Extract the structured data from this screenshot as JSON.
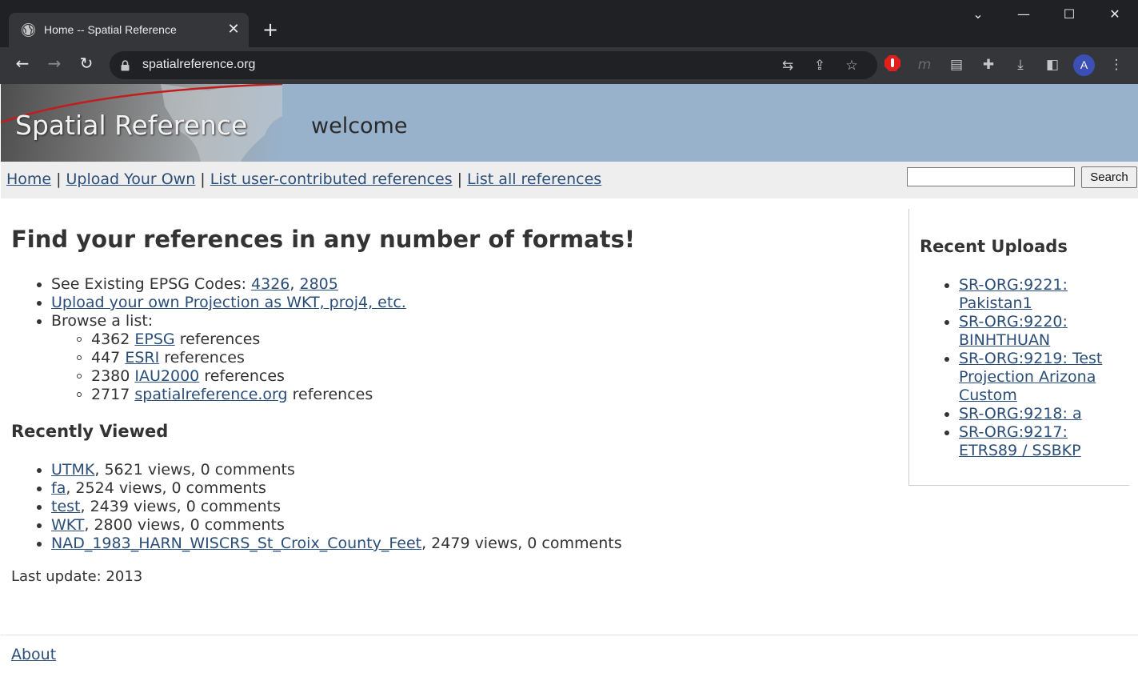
{
  "browser": {
    "tab_title": "Home -- Spatial Reference",
    "new_tab_label": "+",
    "url": "spatialreference.org"
  },
  "site": {
    "logo_text": "Spatial Reference",
    "banner_heading": "welcome"
  },
  "nav": {
    "links": [
      "Home",
      "Upload Your Own",
      "List user-contributed references",
      "List all references"
    ],
    "separator": "|",
    "search_button": "Search",
    "search_value": ""
  },
  "main": {
    "heading": "Find your references in any number of formats!",
    "existing_prefix": "See Existing EPSG Codes: ",
    "existing_codes": [
      "4326",
      "2805"
    ],
    "upload_link": "Upload your own Projection as WKT, proj4, etc.",
    "browse_label": "Browse a list:",
    "browse_items": [
      {
        "count": "4362",
        "link": "EPSG",
        "suffix": " references"
      },
      {
        "count": "447",
        "link": "ESRI",
        "suffix": " references"
      },
      {
        "count": "2380",
        "link": "IAU2000",
        "suffix": " references"
      },
      {
        "count": "2717",
        "link": "spatialreference.org",
        "suffix": " references"
      }
    ],
    "recently_viewed_heading": "Recently Viewed",
    "recently_viewed": [
      {
        "name": "UTMK",
        "stats": ", 5621 views, 0 comments"
      },
      {
        "name": "fa",
        "stats": ", 2524 views, 0 comments"
      },
      {
        "name": "test",
        "stats": ", 2439 views, 0 comments"
      },
      {
        "name": "WKT",
        "stats": ", 2800 views, 0 comments"
      },
      {
        "name": "NAD_1983_HARN_WISCRS_St_Croix_County_Feet",
        "stats": ", 2479 views, 0 comments"
      }
    ],
    "last_update": "Last update: 2013"
  },
  "sidebar": {
    "heading": "Recent Uploads",
    "uploads": [
      [
        "SR-ORG:9221:",
        "Pakistan1"
      ],
      [
        "SR-ORG:9220:",
        "BINHTHUAN"
      ],
      [
        "SR-ORG:9219: Test",
        "Projection Arizona",
        "Custom"
      ],
      [
        "SR-ORG:9218: a"
      ],
      [
        "SR-ORG:9217:",
        "ETRS89 / SSBKP"
      ]
    ]
  },
  "footer": {
    "about_link": "About"
  },
  "icons": {
    "tab_favicon": "globe-icon",
    "toolbar": [
      "back-icon",
      "forward-icon",
      "reload-icon",
      "lock-icon",
      "translate-icon",
      "share-icon",
      "star-icon",
      "adblock-icon",
      "extension-m-icon",
      "reader-icon",
      "puzzle-icon",
      "download-icon",
      "sidepanel-icon",
      "profile-avatar",
      "menu-icon"
    ]
  },
  "colors": {
    "link": "#2b4e78",
    "banner": "#98b2cc",
    "navbar": "#eeeeee",
    "chrome_dark": "#202124",
    "chrome_toolbar": "#35363a"
  },
  "profile_initial": "A"
}
